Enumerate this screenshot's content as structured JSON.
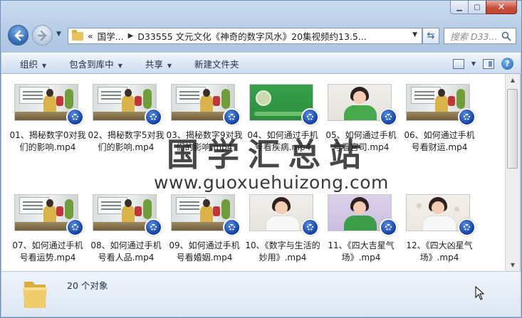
{
  "address": {
    "crumbs": [
      "«",
      "国学...",
      "D33555 文元文化《神奇的数字风水》20集视频约13.5..."
    ]
  },
  "search": {
    "placeholder": "搜索 D33..."
  },
  "commands": [
    {
      "label": "组织",
      "dropdown": true
    },
    {
      "label": "包含到库中",
      "dropdown": true
    },
    {
      "label": "共享",
      "dropdown": true
    },
    {
      "label": "新建文件夹",
      "dropdown": false
    }
  ],
  "files": [
    {
      "name": "01、揭秘数字0对我们的影响.mp4",
      "thumb": "board"
    },
    {
      "name": "02、揭秘数字5对我们的影响.mp4",
      "thumb": "board"
    },
    {
      "name": "03、揭秘数字9对我们的影响.mp4",
      "thumb": "board"
    },
    {
      "name": "04、如何通过手机号看疾病.mp4",
      "thumb": "green"
    },
    {
      "name": "05、如何通过手机号看官司.mp4",
      "thumb": "speaker-green"
    },
    {
      "name": "06、如何通过手机号看财运.mp4",
      "thumb": "board"
    },
    {
      "name": "07、如何通过手机号看运势.mp4",
      "thumb": "board"
    },
    {
      "name": "08、如何通过手机号看人品.mp4",
      "thumb": "board"
    },
    {
      "name": "09、如何通过手机号看婚姻.mp4",
      "thumb": "board"
    },
    {
      "name": "10、《数字与生活的妙用》.mp4",
      "thumb": "speaker-white"
    },
    {
      "name": "11、《四大吉星气场》.mp4",
      "thumb": "speaker-purple"
    },
    {
      "name": "12、《四大凶星气场》.mp4",
      "thumb": "speaker-dots"
    }
  ],
  "status": {
    "count_text": "20 个对象"
  },
  "watermark": {
    "logo_text": "国学汇总站",
    "url": "www.guoxuehuizong.com"
  },
  "colors": {
    "accent": "#2f69b3",
    "window_frame": "#b7cde6",
    "close": "#c7503d"
  }
}
